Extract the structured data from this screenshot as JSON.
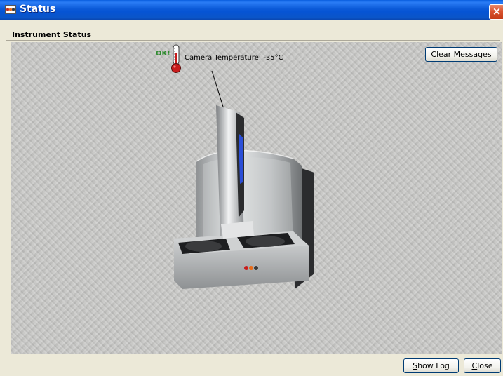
{
  "window": {
    "title": "Status",
    "close_glyph": "×"
  },
  "section": {
    "label": "Instrument Status"
  },
  "indicator": {
    "status": "OK!",
    "camera_temperature_label": "Camera Temperature: -35°C",
    "icon": "thermometer-icon"
  },
  "buttons": {
    "clear_messages": "Clear Messages",
    "show_log_mnemonic": "S",
    "show_log_rest": "how Log",
    "close_mnemonic": "C",
    "close_rest": "lose"
  },
  "colors": {
    "titlebar_blue": "#0a5ad8",
    "ok_green": "#2e8b2e",
    "thermometer_red": "#c81c1c",
    "instrument_accent_blue": "#2b4fd8"
  }
}
